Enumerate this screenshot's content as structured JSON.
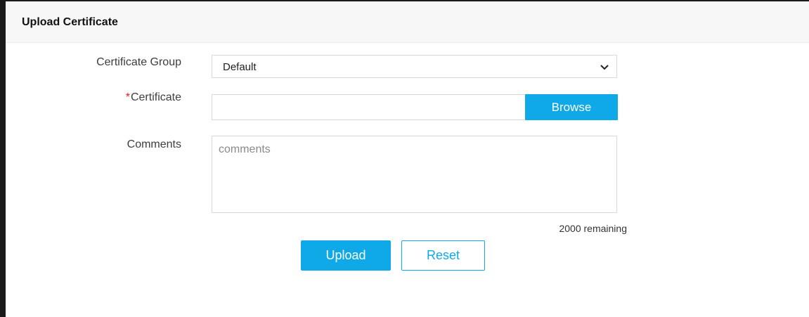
{
  "panel": {
    "title": "Upload Certificate"
  },
  "form": {
    "certificate_group": {
      "label": "Certificate Group",
      "selected": "Default"
    },
    "certificate": {
      "required_mark": "*",
      "label": "Certificate",
      "value": "",
      "browse_label": "Browse"
    },
    "comments": {
      "label": "Comments",
      "placeholder": "comments",
      "value": "",
      "remaining_text": "2000 remaining"
    }
  },
  "actions": {
    "upload_label": "Upload",
    "reset_label": "Reset"
  },
  "icons": {
    "select_caret": "chevron-down-icon"
  },
  "colors": {
    "accent": "#0ea9e6",
    "required": "#e02020"
  }
}
